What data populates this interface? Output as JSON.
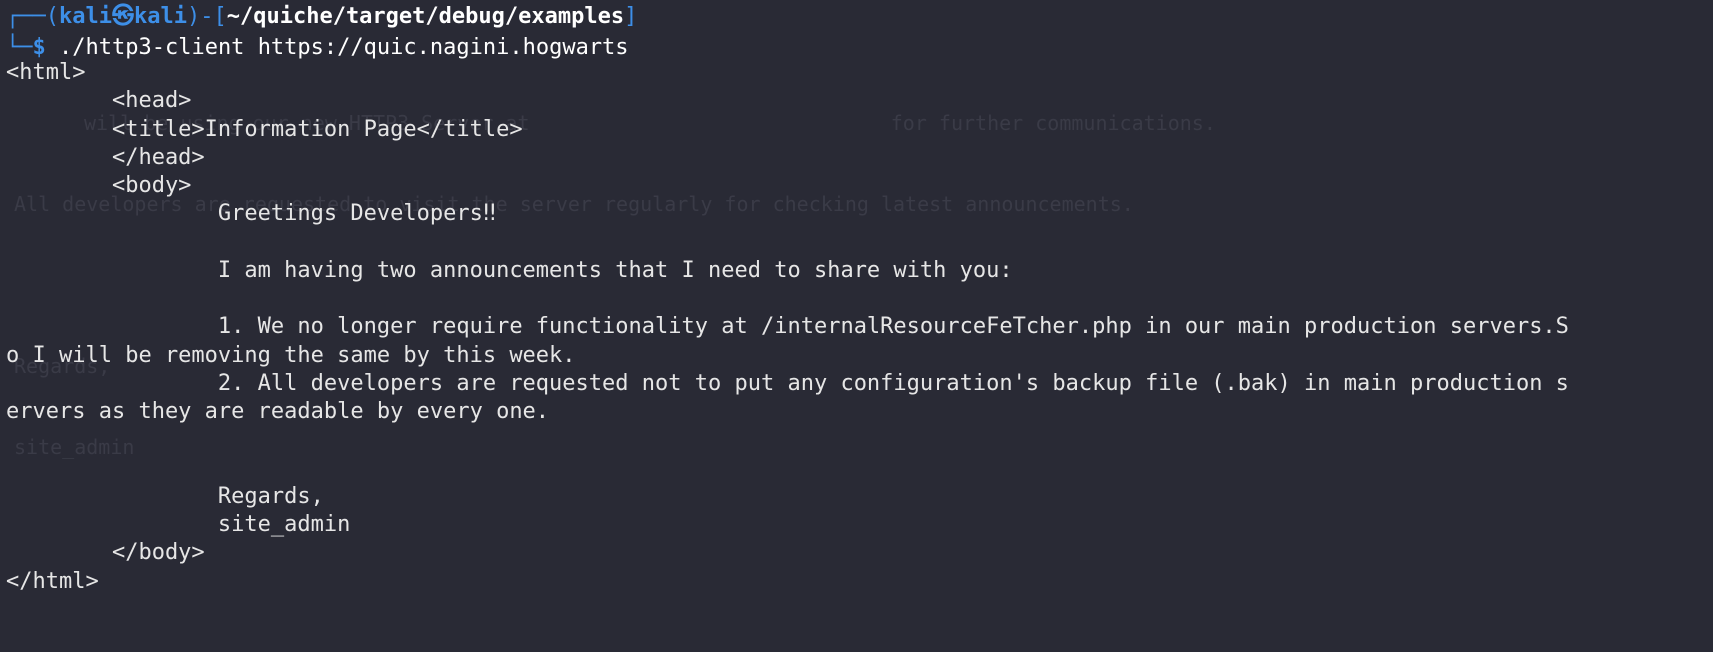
{
  "prompt": {
    "corner_top": "┌──",
    "open_paren": "(",
    "user": "kali",
    "at_symbol": "㉿",
    "host": "kali",
    "close_paren_dash": ")-[",
    "path": "~/quiche/target/debug/examples",
    "close_bracket": "]",
    "corner_bottom": "└─",
    "dollar": "$",
    "command": "./http3-client",
    "argument": "https://quic.nagini.hogwarts"
  },
  "ghost_text": {
    "line1": "will be using our new HTTP3 Server at                              for further communications.",
    "line2": "All developers are requested to visit the server regularly for checking latest announcements.",
    "line3": "Regards,",
    "line4": "site_admin"
  },
  "output": {
    "l01": "<html>",
    "l02": "        <head>",
    "l03": "        <title>Information Page</title>",
    "l04": "        </head>",
    "l05": "        <body>",
    "l06": "                Greetings Developers‼",
    "l07": "",
    "l08": "                I am having two announcements that I need to share with you:",
    "l09": "",
    "l10": "                1. We no longer require functionality at /internalResourceFeTcher.php in our main production servers.S",
    "l11": "o I will be removing the same by this week.",
    "l12": "                2. All developers are requested not to put any configuration's backup file (.bak) in main production s",
    "l13": "ervers as they are readable by every one.",
    "l14": "",
    "l15": "",
    "l16": "                Regards,",
    "l17": "                site_admin",
    "l18": "        </body>",
    "l19": "</html>"
  }
}
